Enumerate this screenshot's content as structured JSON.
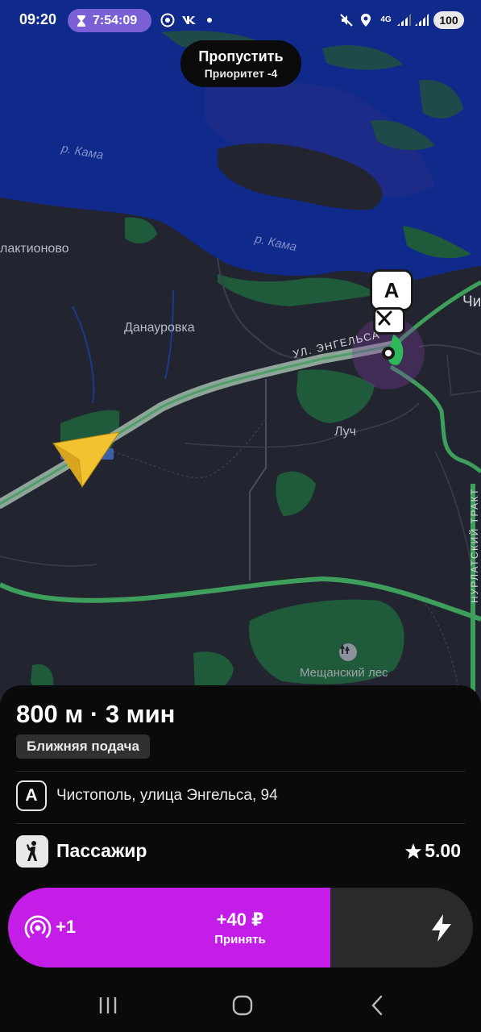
{
  "status_bar": {
    "time": "09:20",
    "timer": "7:54:09",
    "network": "4G",
    "battery": "100",
    "icons": [
      "hourglass-icon",
      "yandex-go-icon",
      "vk-icon",
      "dot-icon",
      "mute-icon",
      "location-icon",
      "signal-icon",
      "wifi-icon"
    ]
  },
  "skip_banner": {
    "title": "Пропустить",
    "subtitle": "Приоритет -4"
  },
  "map": {
    "labels": {
      "river_1": "р. Кама",
      "river_2": "р. Кама",
      "village_1": "лактионово",
      "village_2": "Данауровка",
      "village_3": "Луч",
      "city_fragment": "Чи",
      "street": "УЛ. ЭНГЕЛЬСА",
      "road": "НУРЛАТСКИЙ ТРАКТ",
      "forest": "Мещанский лес"
    },
    "pickup_marker": "A",
    "colors": {
      "water": "#102a8c",
      "land": "#22252f",
      "park": "#1f5a3a",
      "traffic": "#3e9e5c",
      "arrow": "#f2c230"
    }
  },
  "order": {
    "distance_time": "800 м · 3 мин",
    "badge": "Ближняя подача",
    "point_marker": "A",
    "address": "Чистополь, улица Энгельса, 94",
    "passenger_label": "Пассажир",
    "rating": "5.00",
    "queue_count": "+1",
    "price": "+40 ₽",
    "accept_label": "Принять",
    "accent_color": "#c41de8"
  },
  "nav_bar": {
    "recent": "recents-icon",
    "home": "home-icon",
    "back": "back-icon"
  }
}
